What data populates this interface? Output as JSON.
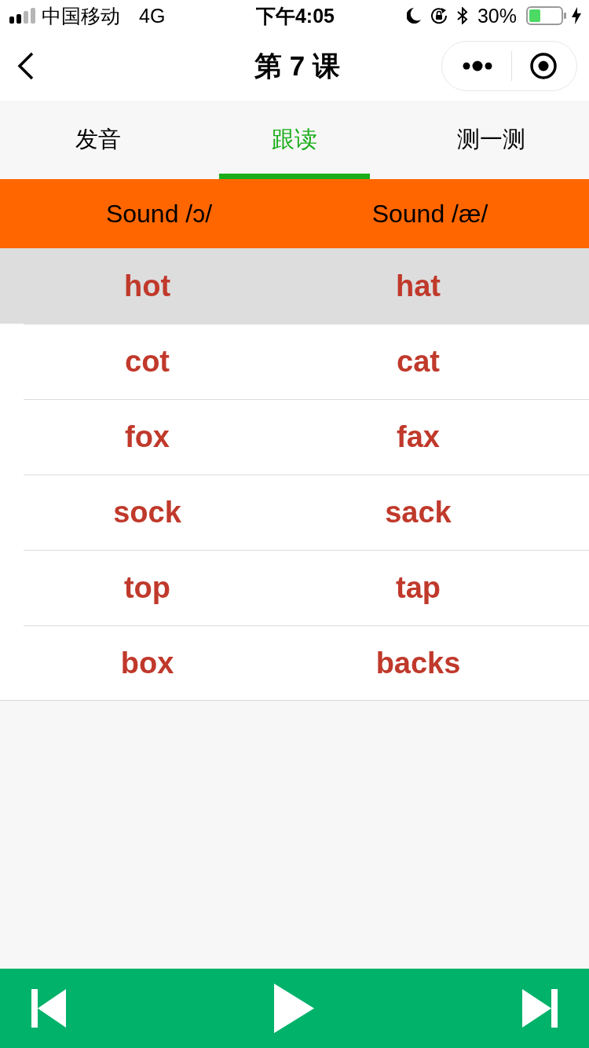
{
  "status_bar": {
    "carrier": "中国移动",
    "network": "4G",
    "time": "下午4:05",
    "battery": "30%"
  },
  "nav": {
    "title": "第 7 课"
  },
  "tabs": [
    {
      "label": "发音",
      "selected": false
    },
    {
      "label": "跟读",
      "selected": true
    },
    {
      "label": "测一测",
      "selected": false
    }
  ],
  "table": {
    "columns": [
      "Sound /ɔ/",
      "Sound /æ/"
    ],
    "rows": [
      {
        "cells": [
          "hot",
          "hat"
        ],
        "selected": true
      },
      {
        "cells": [
          "cot",
          "cat"
        ],
        "selected": false
      },
      {
        "cells": [
          "fox",
          "fax"
        ],
        "selected": false
      },
      {
        "cells": [
          "sock",
          "sack"
        ],
        "selected": false
      },
      {
        "cells": [
          "top",
          "tap"
        ],
        "selected": false
      },
      {
        "cells": [
          "box",
          "backs"
        ],
        "selected": false
      }
    ]
  },
  "player": {
    "buttons": [
      {
        "kind": "previous"
      },
      {
        "kind": "play"
      },
      {
        "kind": "next"
      }
    ]
  }
}
